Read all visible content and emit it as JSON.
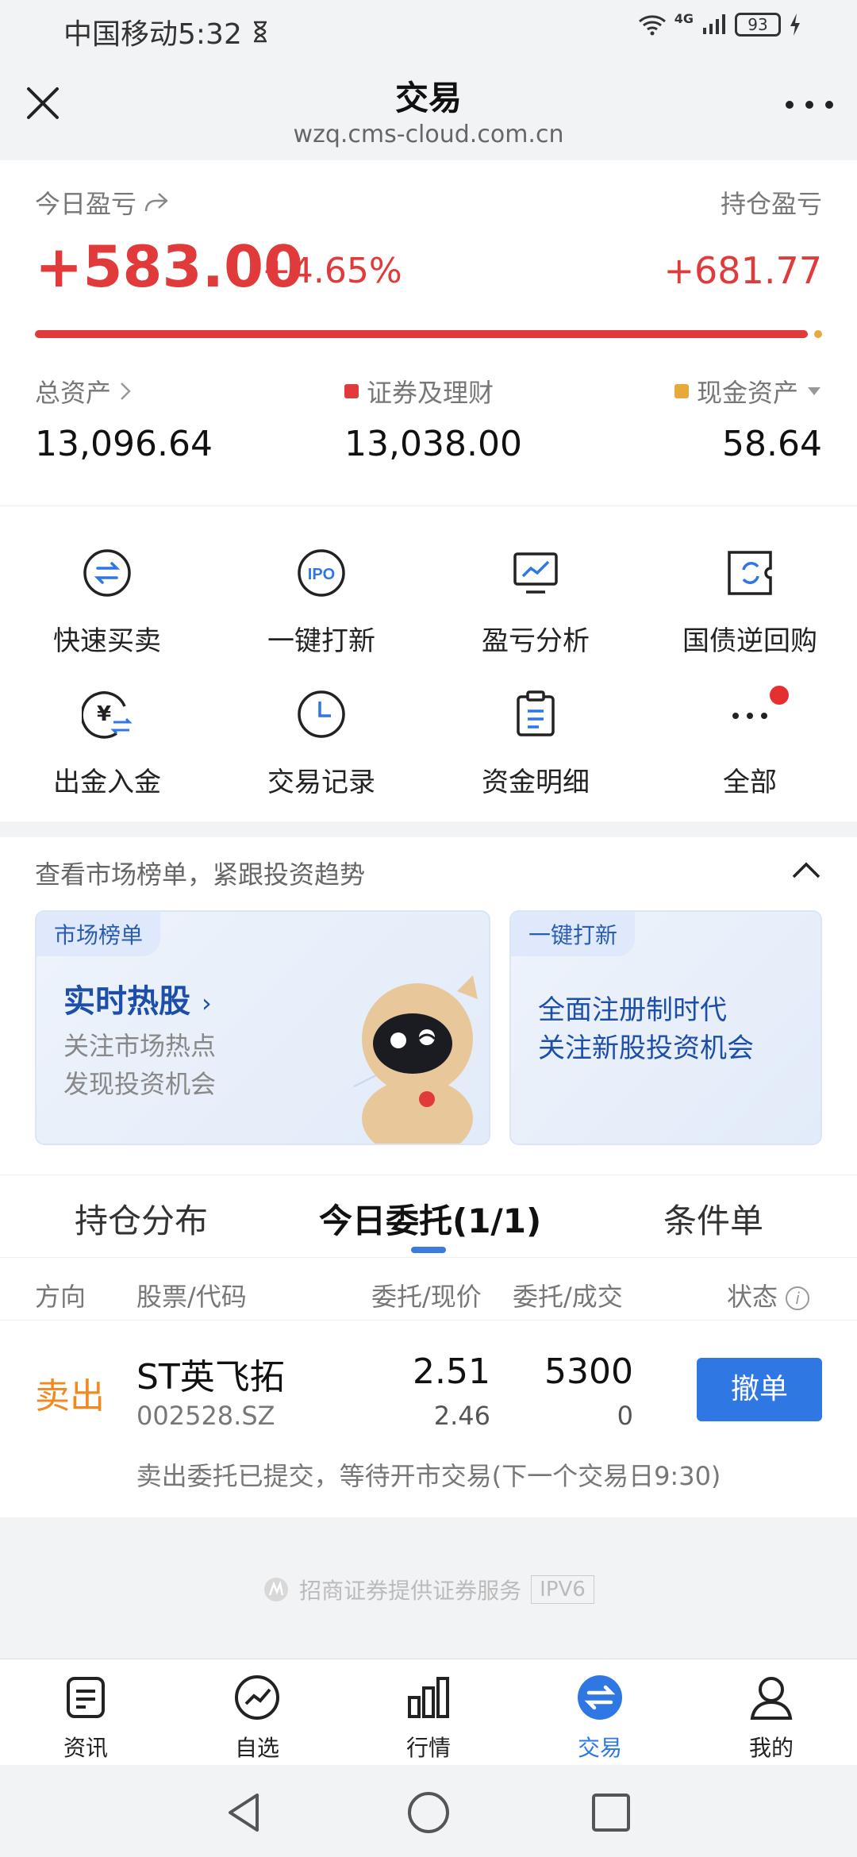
{
  "status_bar": {
    "carrier_time": "中国移动5:32",
    "battery": "93",
    "network": "4G"
  },
  "header": {
    "title": "交易",
    "url": "wzq.cms-cloud.com.cn"
  },
  "summary": {
    "today_pl_label": "今日盈亏",
    "today_pl_value": "+583.00",
    "today_pl_pct": "+4.65%",
    "hold_pl_label": "持仓盈亏",
    "hold_pl_value": "+681.77",
    "securities_ratio": 0.9955,
    "total_assets_label": "总资产",
    "total_assets_value": "13,096.64",
    "securities_label": "证券及理财",
    "securities_value": "13,038.00",
    "cash_label": "现金资产",
    "cash_value": "58.64",
    "colors": {
      "profit": "#e03a3a",
      "cash": "#e8a93b"
    }
  },
  "actions": [
    {
      "label": "快速买卖",
      "icon": "swap-icon"
    },
    {
      "label": "一键打新",
      "icon": "ipo-icon"
    },
    {
      "label": "盈亏分析",
      "icon": "chart-monitor-icon"
    },
    {
      "label": "国债逆回购",
      "icon": "bond-repo-icon"
    },
    {
      "label": "出金入金",
      "icon": "yuan-transfer-icon"
    },
    {
      "label": "交易记录",
      "icon": "clock-icon"
    },
    {
      "label": "资金明细",
      "icon": "clipboard-icon"
    },
    {
      "label": "全部",
      "icon": "more-dots-icon"
    }
  ],
  "market": {
    "title": "查看市场榜单，紧跟投资趋势",
    "card1": {
      "tag": "市场榜单",
      "title": "实时热股",
      "line1": "关注市场热点",
      "line2": "发现投资机会"
    },
    "card2": {
      "tag": "一键打新",
      "line1": "全面注册制时代",
      "line2": "关注新股投资机会"
    }
  },
  "orders": {
    "tabs": [
      "持仓分布",
      "今日委托(1/1)",
      "条件单"
    ],
    "columns": {
      "direction": "方向",
      "stock": "股票/代码",
      "price": "委托/现价",
      "volume": "委托/成交",
      "status": "状态"
    },
    "rows": [
      {
        "direction": "卖出",
        "name": "ST英飞拓",
        "code": "002528.SZ",
        "order_price": "2.51",
        "current_price": "2.46",
        "order_volume": "5300",
        "filled_volume": "0",
        "action": "撤单",
        "note": "卖出委托已提交，等待开市交易(下一个交易日9:30)"
      }
    ]
  },
  "footer": {
    "provider": "招商证券提供证券服务",
    "ipv6": "IPV6"
  },
  "bottom_nav": [
    {
      "label": "资讯",
      "icon": "news-icon"
    },
    {
      "label": "自选",
      "icon": "watchlist-icon"
    },
    {
      "label": "行情",
      "icon": "market-bars-icon"
    },
    {
      "label": "交易",
      "icon": "trade-icon",
      "active": true
    },
    {
      "label": "我的",
      "icon": "profile-icon"
    }
  ]
}
